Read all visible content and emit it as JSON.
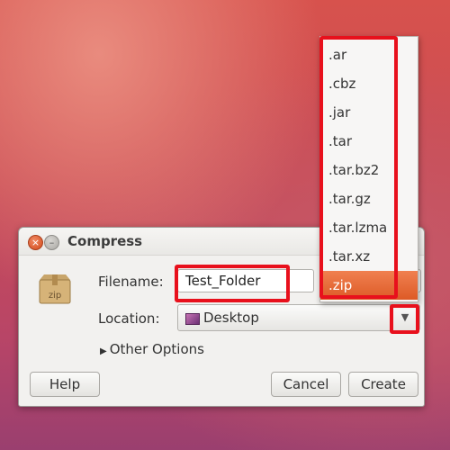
{
  "dialog": {
    "title": "Compress",
    "filename_label": "Filename:",
    "filename_value": "Test_Folder",
    "location_label": "Location:",
    "location_value": "Desktop",
    "other_options": "Other Options",
    "buttons": {
      "help": "Help",
      "cancel": "Cancel",
      "create": "Create"
    },
    "icon_text": "zip"
  },
  "dropdown": {
    "items": [
      ".ar",
      ".cbz",
      ".jar",
      ".tar",
      ".tar.bz2",
      ".tar.gz",
      ".tar.lzma",
      ".tar.xz",
      ".zip"
    ],
    "selected": ".zip"
  },
  "colors": {
    "highlight": "#e8101c",
    "selection": "#dd5a26"
  },
  "icons": [
    "close-icon",
    "minimize-icon",
    "zip-archive-icon",
    "desktop-folder-icon",
    "chevron-down-icon",
    "disclosure-triangle-icon"
  ]
}
